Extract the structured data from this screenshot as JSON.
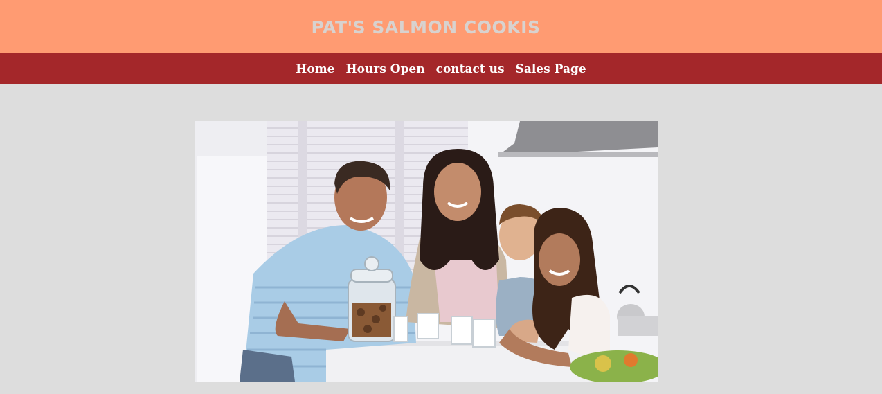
{
  "header": {
    "title": "PAT'S SALMON COOKIS",
    "background": "#ff9b72",
    "title_color": "#d8d2cf"
  },
  "nav": {
    "background": "#a4272a",
    "items": [
      {
        "label": "Home"
      },
      {
        "label": "Hours Open"
      },
      {
        "label": "contact us"
      },
      {
        "label": "Sales Page"
      }
    ]
  },
  "page": {
    "background": "#dddddd"
  }
}
